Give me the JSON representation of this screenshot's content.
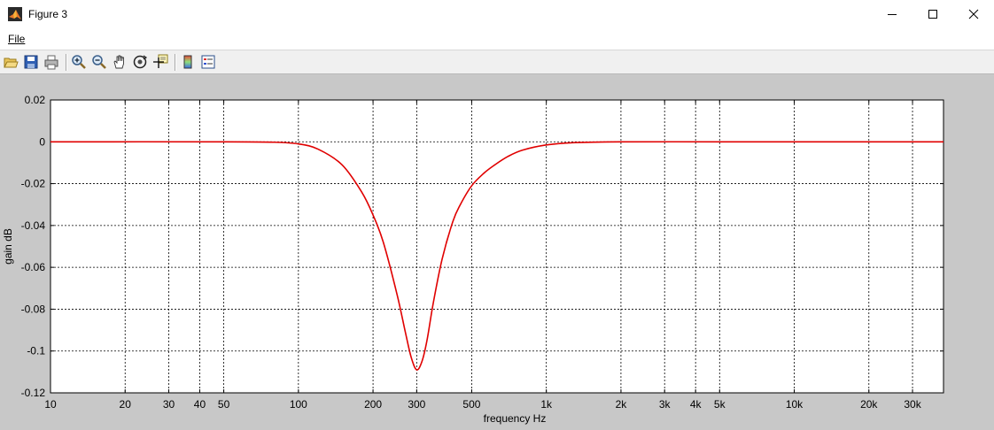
{
  "window": {
    "title": "Figure 3",
    "controls": [
      "minimize",
      "maximize",
      "close"
    ]
  },
  "menu": {
    "items": [
      {
        "label": "File"
      }
    ]
  },
  "toolbar": {
    "buttons": [
      {
        "name": "open-icon"
      },
      {
        "name": "save-icon"
      },
      {
        "name": "print-icon"
      },
      {
        "name": "zoom-in-icon"
      },
      {
        "name": "zoom-out-icon"
      },
      {
        "name": "pan-icon"
      },
      {
        "name": "rotate-3d-icon"
      },
      {
        "name": "data-cursor-icon"
      },
      {
        "name": "colorbar-icon"
      },
      {
        "name": "legend-icon"
      }
    ]
  },
  "colors": {
    "figure_bg": "#c8c8c8",
    "axes_bg": "#ffffff",
    "line": "#e00000"
  },
  "chart_data": {
    "type": "line",
    "xlabel": "frequency   Hz",
    "ylabel": "gain dB",
    "xscale": "log",
    "xlim": [
      10,
      40000
    ],
    "ylim": [
      -0.12,
      0.02
    ],
    "grid": true,
    "xticks": [
      {
        "v": 10,
        "label": "10"
      },
      {
        "v": 20,
        "label": "20"
      },
      {
        "v": 30,
        "label": "30"
      },
      {
        "v": 40,
        "label": "40"
      },
      {
        "v": 50,
        "label": "50"
      },
      {
        "v": 100,
        "label": "100"
      },
      {
        "v": 200,
        "label": "200"
      },
      {
        "v": 300,
        "label": "300"
      },
      {
        "v": 500,
        "label": "500"
      },
      {
        "v": 1000,
        "label": "1k"
      },
      {
        "v": 2000,
        "label": "2k"
      },
      {
        "v": 3000,
        "label": "3k"
      },
      {
        "v": 4000,
        "label": "4k"
      },
      {
        "v": 5000,
        "label": "5k"
      },
      {
        "v": 10000,
        "label": "10k"
      },
      {
        "v": 20000,
        "label": "20k"
      },
      {
        "v": 30000,
        "label": "30k"
      }
    ],
    "yticks": [
      {
        "v": 0.02,
        "label": "0.02"
      },
      {
        "v": 0,
        "label": "0"
      },
      {
        "v": -0.02,
        "label": "-0.02"
      },
      {
        "v": -0.04,
        "label": "-0.04"
      },
      {
        "v": -0.06,
        "label": "-0.06"
      },
      {
        "v": -0.08,
        "label": "-0.08"
      },
      {
        "v": -0.1,
        "label": "-0.1"
      },
      {
        "v": -0.12,
        "label": "-0.12"
      }
    ],
    "series": [
      {
        "color": "#e00000",
        "x": [
          10,
          50,
          80,
          100,
          120,
          150,
          180,
          200,
          220,
          250,
          270,
          285,
          300,
          315,
          330,
          350,
          380,
          420,
          450,
          500,
          560,
          620,
          700,
          800,
          1000,
          1300,
          2000,
          5000,
          10000,
          40000
        ],
        "y": [
          0,
          0,
          -0.0002,
          -0.001,
          -0.0035,
          -0.011,
          -0.024,
          -0.035,
          -0.048,
          -0.073,
          -0.091,
          -0.103,
          -0.109,
          -0.105,
          -0.095,
          -0.077,
          -0.056,
          -0.038,
          -0.03,
          -0.021,
          -0.015,
          -0.011,
          -0.007,
          -0.004,
          -0.0015,
          -0.0004,
          0,
          0,
          0,
          0
        ]
      }
    ]
  }
}
